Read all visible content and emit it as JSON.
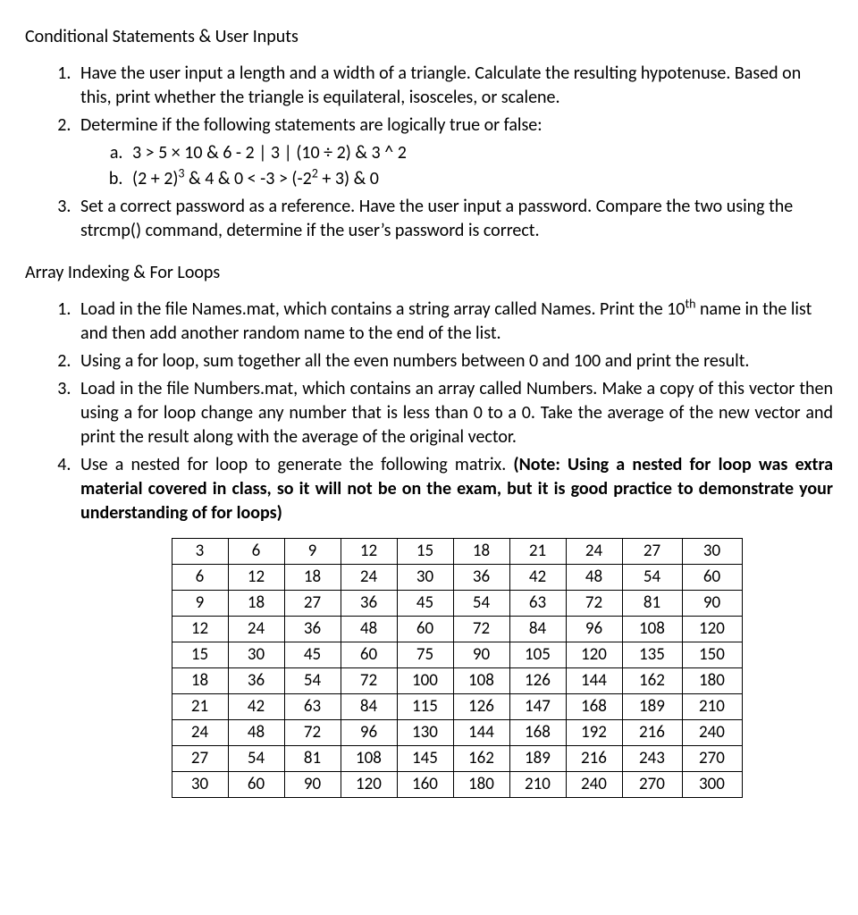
{
  "headings": {
    "section1": "Conditional Statements & User Inputs",
    "section2": "Array Indexing & For Loops"
  },
  "section1": {
    "q1": "Have the user input a length and a width of a triangle. Calculate the resulting hypotenuse. Based on this, print whether the triangle is equilateral, isosceles, or scalene.",
    "q2": "Determine if the following statements are logically true or false:",
    "q2a": "3 > 5 × 10 & 6 - 2 | 3 | (10 ÷ 2) & 3 ^ 2",
    "q2b_pre": "(2 + 2)",
    "q2b_exp1": "3",
    "q2b_mid": " & 4 & 0 < -3 > (-2",
    "q2b_exp2": "2",
    "q2b_post": " + 3) & 0",
    "q3": "Set a correct password as a reference. Have the user input a password. Compare the two using the strcmp() command, determine if the user’s password is correct."
  },
  "section2": {
    "q1_pre": "Load in the file Names.mat, which contains a string array called Names. Print the 10",
    "q1_sup": "th",
    "q1_post": " name in the list and then add another random name to the end of the list.",
    "q2": "Using a for loop, sum together all the even numbers between 0 and 100 and print the result.",
    "q3": "Load in the file Numbers.mat, which contains an array called Numbers. Make a copy of this vector then using a for loop change any number that is less than 0 to a 0. Take the average of the new vector and print the result along with the average of the original vector.",
    "q4_pre": "Use a nested for loop to generate the following matrix. ",
    "q4_bold": "(Note: Using a nested for loop was extra material covered in class, so it will not be on the exam, but it is good practice to demonstrate your understanding of for loops)"
  },
  "matrix": [
    [
      3,
      6,
      9,
      12,
      15,
      18,
      21,
      24,
      27,
      30
    ],
    [
      6,
      12,
      18,
      24,
      30,
      36,
      42,
      48,
      54,
      60
    ],
    [
      9,
      18,
      27,
      36,
      45,
      54,
      63,
      72,
      81,
      90
    ],
    [
      12,
      24,
      36,
      48,
      60,
      72,
      84,
      96,
      108,
      120
    ],
    [
      15,
      30,
      45,
      60,
      75,
      90,
      105,
      120,
      135,
      150
    ],
    [
      18,
      36,
      54,
      72,
      100,
      108,
      126,
      144,
      162,
      180
    ],
    [
      21,
      42,
      63,
      84,
      115,
      126,
      147,
      168,
      189,
      210
    ],
    [
      24,
      48,
      72,
      96,
      130,
      144,
      168,
      192,
      216,
      240
    ],
    [
      27,
      54,
      81,
      108,
      145,
      162,
      189,
      216,
      243,
      270
    ],
    [
      30,
      60,
      90,
      120,
      160,
      180,
      210,
      240,
      270,
      300
    ]
  ]
}
